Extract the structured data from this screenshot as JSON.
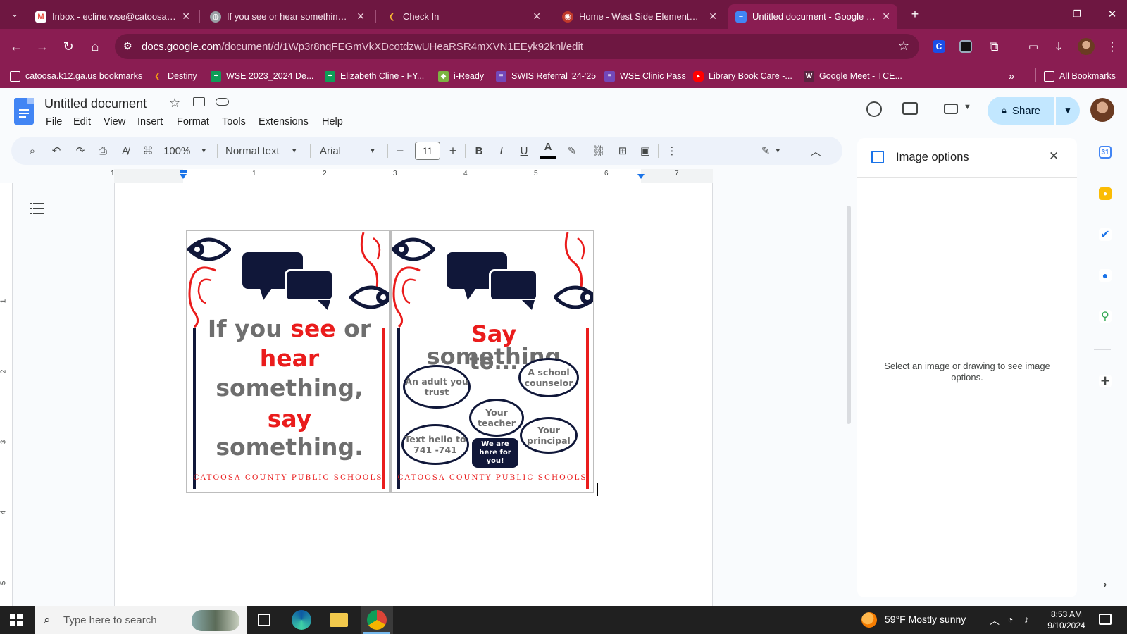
{
  "tabs": [
    {
      "title": "Inbox - ecline.wse@catoosa.k12",
      "icon": "gmail-icon",
      "close": "✕"
    },
    {
      "title": "If you see or hear something, sa",
      "icon": "globe-icon",
      "close": "✕"
    },
    {
      "title": "Check In",
      "icon": "checkin-icon",
      "close": "✕"
    },
    {
      "title": "Home - West Side Elementary S",
      "icon": "school-icon",
      "close": "✕"
    },
    {
      "title": "Untitled document - Google Do",
      "icon": "docs-icon",
      "close": "✕"
    }
  ],
  "address": {
    "host": "docs.google.com",
    "path": "/document/d/1Wp3r8nqFEGmVkXDcotdzwUHeaRSR4mXVN1EEyk92knl/edit"
  },
  "bookmarks": [
    {
      "label": "catoosa.k12.ga.us bookmarks",
      "icon": "folder-icon"
    },
    {
      "label": "Destiny",
      "icon": "destiny-icon"
    },
    {
      "label": "WSE 2023_2024 De...",
      "icon": "sheets-icon"
    },
    {
      "label": "Elizabeth Cline - FY...",
      "icon": "sheets-icon"
    },
    {
      "label": "i-Ready",
      "icon": "iready-icon"
    },
    {
      "label": "SWIS Referral '24-'25",
      "icon": "forms-icon"
    },
    {
      "label": "WSE Clinic Pass",
      "icon": "forms-icon"
    },
    {
      "label": "Library Book Care -...",
      "icon": "youtube-icon"
    },
    {
      "label": "Google Meet - TCE...",
      "icon": "meet-icon"
    }
  ],
  "bookmarks_more": "»",
  "all_bookmarks": "All Bookmarks",
  "doc": {
    "title": "Untitled document",
    "menus": [
      "File",
      "Edit",
      "View",
      "Insert",
      "Format",
      "Tools",
      "Extensions",
      "Help"
    ],
    "share_label": "Share"
  },
  "toolbar": {
    "zoom": "100%",
    "style": "Normal text",
    "font": "Arial",
    "size": "11",
    "bold": "B",
    "italic": "I",
    "underline": "U",
    "text_color": "A",
    "minus": "−",
    "plus": "+"
  },
  "ruler": {
    "h_labels": [
      "1",
      "1",
      "2",
      "3",
      "4",
      "5",
      "6",
      "7"
    ],
    "v_labels": [
      "1",
      "2",
      "3",
      "4",
      "5"
    ]
  },
  "poster_left": {
    "line1a": "If you ",
    "line1b": "see",
    "line1c": " or",
    "line2": "hear",
    "line3": "something,",
    "line4": "say",
    "line5": "something.",
    "footer": "CATOOSA COUNTY PUBLIC SCHOOLS"
  },
  "poster_right": {
    "say": "Say",
    "something": " something",
    "to": "to...",
    "bubbles": [
      "An adult you trust",
      "A school counselor",
      "Your teacher",
      "Text hello to 741 -741",
      "Your principal"
    ],
    "dark_bubble": "We are here for you!",
    "footer": "CATOOSA COUNTY PUBLIC SCHOOLS"
  },
  "side_panel": {
    "title": "Image options",
    "message": "Select an image or drawing to see image options."
  },
  "taskbar": {
    "search_placeholder": "Type here to search",
    "weather": "59°F  Mostly sunny",
    "time": "8:53 AM",
    "date": "9/10/2024"
  },
  "colors": {
    "chrome_dark": "#6e1741",
    "chrome": "#8a1d52",
    "poster_navy": "#101739",
    "poster_red": "#ea1c1c",
    "share_bg": "#c2e7ff"
  }
}
